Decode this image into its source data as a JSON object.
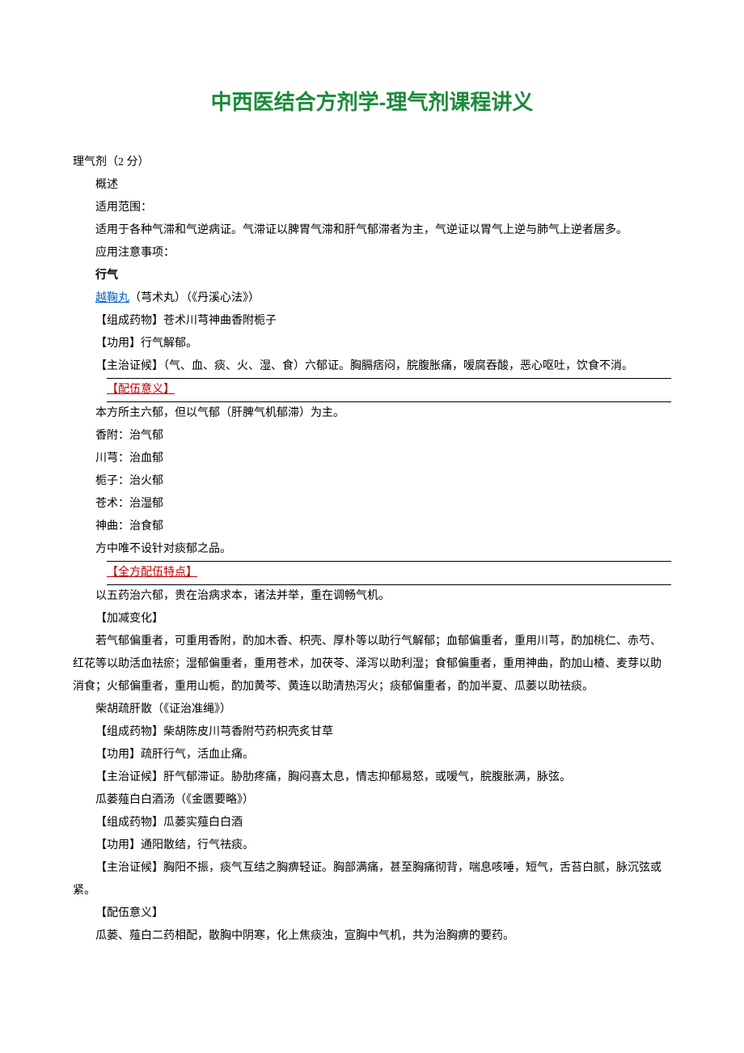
{
  "title": "中西医结合方剂学-理气剂课程讲义",
  "section_header": "理气剂（2 分）",
  "overview": {
    "label": "概述",
    "scope_label": "适用范围：",
    "scope_text": "适用于各种气滞和气逆病证。气滞证以脾胃气滞和肝气郁滞者为主，气逆证以胃气上逆与肺气上逆者居多。",
    "note_label": "应用注意事项："
  },
  "xingqi": {
    "label": "行气",
    "yuejuwan": {
      "name": "越鞠丸",
      "alias": "（芎术丸）（《丹溪心法》）",
      "composition_label": "【组成药物】",
      "composition": "苍术川芎神曲香附栀子",
      "function_label": "【功用】",
      "function_text": "行气解郁。",
      "indication_label": "【主治证候】",
      "indication_text": "（气、血、痰、火、湿、食）六郁证。胸膈痞闷，脘腹胀痛，嗳腐吞酸，恶心呕吐，饮食不消。",
      "peiwu_label": "【配伍意义】",
      "peiwu_intro": "本方所主六郁，但以气郁（肝脾气机郁滞）为主。",
      "items": [
        "香附：治气郁",
        "川芎：治血郁",
        "栀子：治火郁",
        "苍术：治湿郁",
        "神曲：治食郁"
      ],
      "peiwu_note": "方中唯不设针对痰郁之品。",
      "feature_label": "【全方配伍特点】",
      "feature_text": "以五药治六郁，贵在治病求本，诸法并举，重在调畅气机。",
      "variation_label": "【加减变化】",
      "variation_text": "若气郁偏重者，可重用香附，酌加木香、枳壳、厚朴等以助行气解郁；血郁偏重者，重用川芎，酌加桃仁、赤芍、红花等以助活血祛瘀；湿郁偏重者，重用苍术，加茯苓、泽泻以助利湿；食郁偏重者，重用神曲，酌加山楂、麦芽以助消食；火郁偏重者，重用山栀，酌加黄芩、黄连以助清热泻火；痰郁偏重者，酌加半夏、瓜蒌以助祛痰。"
    },
    "chaihushugan": {
      "name": "柴胡疏肝散（《证治准绳》）",
      "composition_label": "【组成药物】",
      "composition": "柴胡陈皮川芎香附芍药枳壳炙甘草",
      "function_label": "【功用】",
      "function_text": "疏肝行气，活血止痛。",
      "indication_label": "【主治证候】",
      "indication_text": "肝气郁滞证。胁肋疼痛，胸闷喜太息，情志抑郁易怒，或嗳气，脘腹胀满，脉弦。"
    },
    "gualouxiebai": {
      "name": "瓜蒌薤白白酒汤（《金匮要略》）",
      "composition_label": "【组成药物】",
      "composition": "瓜蒌实薤白白酒",
      "function_label": "【功用】",
      "function_text": "通阳散结，行气祛痰。",
      "indication_label": "【主治证候】",
      "indication_text": "胸阳不振，痰气互结之胸痹轻证。胸部满痛，甚至胸痛彻背，喘息咳唾，短气，舌苔白腻，脉沉弦或紧。",
      "peiwu_label": "【配伍意义】",
      "peiwu_text": "瓜蒌、薤白二药相配，散胸中阴寒，化上焦痰浊，宣胸中气机，共为治胸痹的要药。"
    }
  }
}
